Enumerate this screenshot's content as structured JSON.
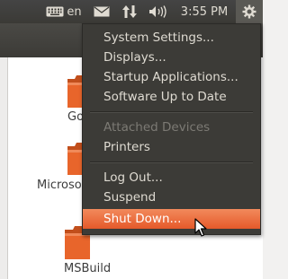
{
  "topbar": {
    "keyboard_layout": "en",
    "clock": "3:55 PM",
    "icons": [
      "keyboard-icon",
      "mail-icon",
      "network-icon",
      "volume-icon",
      "gear-icon"
    ]
  },
  "desktop": {
    "folders": [
      {
        "label": "Go"
      },
      {
        "label": "Microso"
      },
      {
        "label": "MSBuild"
      }
    ],
    "folder_color": "#e8652b"
  },
  "system_menu": {
    "items": [
      {
        "label": "System Settings..."
      },
      {
        "label": "Displays..."
      },
      {
        "label": "Startup Applications..."
      },
      {
        "label": "Software Up to Date"
      },
      {
        "label": "Attached Devices"
      },
      {
        "label": "Printers"
      },
      {
        "label": "Log Out..."
      },
      {
        "label": "Suspend"
      },
      {
        "label": "Shut Down..."
      }
    ],
    "highlight_color": "#e9632f"
  }
}
